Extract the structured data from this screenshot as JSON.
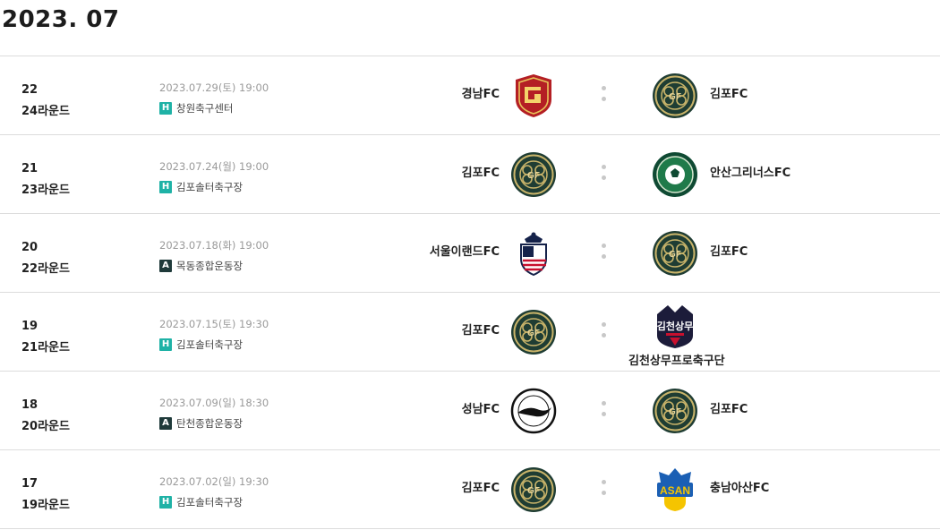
{
  "month_title": "2023. 07",
  "matches": [
    {
      "game_no": "22",
      "round": "24라운드",
      "datetime": "2023.07.29(토) 19:00",
      "venue_type": "H",
      "venue": "창원축구센터",
      "home": "경남FC",
      "away": "김포FC",
      "home_logo": "gyeongnam-logo",
      "away_logo": "gimpo-logo"
    },
    {
      "game_no": "21",
      "round": "23라운드",
      "datetime": "2023.07.24(월) 19:00",
      "venue_type": "H",
      "venue": "김포솔터축구장",
      "home": "김포FC",
      "away": "안산그리너스FC",
      "home_logo": "gimpo-logo",
      "away_logo": "ansan-logo"
    },
    {
      "game_no": "20",
      "round": "22라운드",
      "datetime": "2023.07.18(화) 19:00",
      "venue_type": "A",
      "venue": "목동종합운동장",
      "home": "서울이랜드FC",
      "away": "김포FC",
      "home_logo": "seoul-eland-logo",
      "away_logo": "gimpo-logo"
    },
    {
      "game_no": "19",
      "round": "21라운드",
      "datetime": "2023.07.15(토) 19:30",
      "venue_type": "H",
      "venue": "김포솔터축구장",
      "home": "김포FC",
      "away": "김천상무프로축구단",
      "home_logo": "gimpo-logo",
      "away_logo": "gimcheon-logo"
    },
    {
      "game_no": "18",
      "round": "20라운드",
      "datetime": "2023.07.09(일) 18:30",
      "venue_type": "A",
      "venue": "탄천종합운동장",
      "home": "성남FC",
      "away": "김포FC",
      "home_logo": "seongnam-logo",
      "away_logo": "gimpo-logo"
    },
    {
      "game_no": "17",
      "round": "19라운드",
      "datetime": "2023.07.02(일) 19:30",
      "venue_type": "H",
      "venue": "김포솔터축구장",
      "home": "김포FC",
      "away": "충남아산FC",
      "home_logo": "gimpo-logo",
      "away_logo": "asan-logo"
    }
  ],
  "colors": {
    "home_badge": "#1fb2a6",
    "away_badge": "#1f3a3a",
    "date_text": "#9a9a9a",
    "divider": "#dcdcdc"
  }
}
